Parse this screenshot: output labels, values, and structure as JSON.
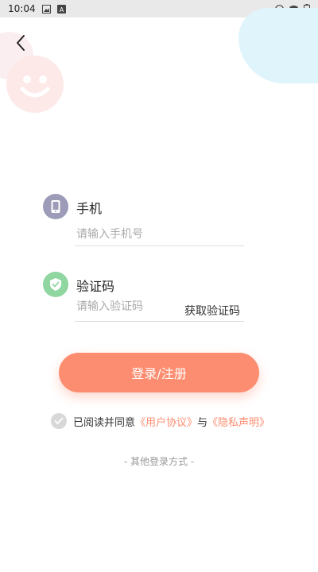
{
  "status_bar": {
    "time": "10:04"
  },
  "phone": {
    "label": "手机",
    "placeholder": "请输入手机号",
    "value": ""
  },
  "code": {
    "label": "验证码",
    "placeholder": "请输入验证码",
    "value": "",
    "get_code_label": "获取验证码"
  },
  "login_button": "登录/注册",
  "agreement": {
    "prefix": "已阅读并同意",
    "user_agreement": "《用户协议》",
    "and": "与",
    "privacy": "《隐私声明》"
  },
  "other_login": "- 其他登录方式 -",
  "colors": {
    "accent": "#fd8d70",
    "phone_icon_bg": "#9c9bb8",
    "shield_icon_bg": "#8fd6a1"
  }
}
